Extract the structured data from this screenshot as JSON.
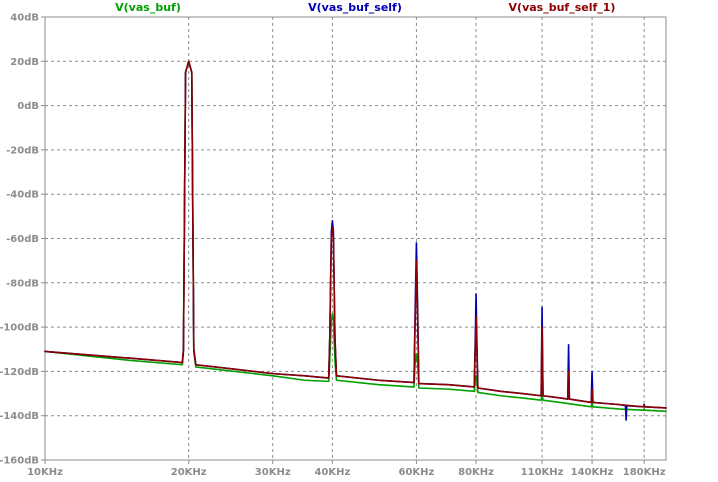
{
  "chart_data": {
    "type": "line",
    "x_scale": "log",
    "y_scale": "linear",
    "grid": true,
    "legend_position": "top",
    "xlim": [
      10000,
      200000
    ],
    "ylim": [
      -160,
      40
    ],
    "x_ticks": [
      {
        "value": 10000,
        "label": "10KHz"
      },
      {
        "value": 20000,
        "label": "20KHz"
      },
      {
        "value": 30000,
        "label": "30KHz"
      },
      {
        "value": 40000,
        "label": "40KHz"
      },
      {
        "value": 60000,
        "label": "60KHz"
      },
      {
        "value": 80000,
        "label": "80KHz"
      },
      {
        "value": 110000,
        "label": "110KHz"
      },
      {
        "value": 140000,
        "label": "140KHz"
      },
      {
        "value": 180000,
        "label": "180KHz"
      }
    ],
    "y_ticks": [
      {
        "value": 40,
        "label": "40dB"
      },
      {
        "value": 20,
        "label": "20dB"
      },
      {
        "value": 0,
        "label": "0dB"
      },
      {
        "value": -20,
        "label": "-20dB"
      },
      {
        "value": -40,
        "label": "-40dB"
      },
      {
        "value": -60,
        "label": "-60dB"
      },
      {
        "value": -80,
        "label": "-80dB"
      },
      {
        "value": -100,
        "label": "-100dB"
      },
      {
        "value": -120,
        "label": "-120dB"
      },
      {
        "value": -140,
        "label": "-140dB"
      },
      {
        "value": -160,
        "label": "-160dB"
      }
    ],
    "series": [
      {
        "name": "V(vas_buf)",
        "color": "#00a000",
        "points": [
          [
            10000,
            -111
          ],
          [
            15000,
            -115
          ],
          [
            19400,
            -117
          ],
          [
            19500,
            -111
          ],
          [
            19700,
            15
          ],
          [
            20000,
            20
          ],
          [
            20300,
            15
          ],
          [
            20500,
            -111
          ],
          [
            20700,
            -118
          ],
          [
            25000,
            -120
          ],
          [
            30000,
            -122
          ],
          [
            35000,
            -124
          ],
          [
            39300,
            -124.5
          ],
          [
            39500,
            -115
          ],
          [
            39800,
            -97
          ],
          [
            40000,
            -94
          ],
          [
            40200,
            -97
          ],
          [
            40500,
            -115
          ],
          [
            40800,
            -124
          ],
          [
            50000,
            -126
          ],
          [
            59000,
            -127
          ],
          [
            59300,
            -127
          ],
          [
            59600,
            -117
          ],
          [
            60000,
            -112
          ],
          [
            60400,
            -117
          ],
          [
            60700,
            -127.5
          ],
          [
            70000,
            -128
          ],
          [
            79300,
            -129
          ],
          [
            79700,
            -124
          ],
          [
            80000,
            -122
          ],
          [
            80300,
            -124
          ],
          [
            80700,
            -129.5
          ],
          [
            90000,
            -131
          ],
          [
            100000,
            -132
          ],
          [
            109500,
            -133
          ],
          [
            110000,
            -130
          ],
          [
            110500,
            -133
          ],
          [
            120000,
            -134
          ],
          [
            139400,
            -136
          ],
          [
            140000,
            -134
          ],
          [
            140600,
            -136
          ],
          [
            160000,
            -137
          ],
          [
            179500,
            -137.5
          ],
          [
            180000,
            -137
          ],
          [
            180500,
            -137.5
          ],
          [
            200000,
            -138
          ]
        ]
      },
      {
        "name": "V(vas_buf_self)",
        "color": "#0000b0",
        "points": [
          [
            10000,
            -111
          ],
          [
            15000,
            -114
          ],
          [
            19400,
            -116
          ],
          [
            19500,
            -110
          ],
          [
            19700,
            15
          ],
          [
            20000,
            20
          ],
          [
            20300,
            15
          ],
          [
            20500,
            -110
          ],
          [
            20700,
            -117
          ],
          [
            25000,
            -119
          ],
          [
            30000,
            -121
          ],
          [
            35000,
            -122
          ],
          [
            39300,
            -123
          ],
          [
            39500,
            -105
          ],
          [
            39800,
            -57
          ],
          [
            40000,
            -52
          ],
          [
            40200,
            -57
          ],
          [
            40500,
            -105
          ],
          [
            40800,
            -122
          ],
          [
            50000,
            -124
          ],
          [
            59000,
            -125
          ],
          [
            59300,
            -125
          ],
          [
            59600,
            -95
          ],
          [
            60000,
            -62
          ],
          [
            60400,
            -95
          ],
          [
            60700,
            -125.5
          ],
          [
            70000,
            -126
          ],
          [
            79300,
            -127
          ],
          [
            79700,
            -105
          ],
          [
            80000,
            -85
          ],
          [
            80300,
            -105
          ],
          [
            80700,
            -127.5
          ],
          [
            90000,
            -129
          ],
          [
            100000,
            -130
          ],
          [
            109500,
            -131
          ],
          [
            110000,
            -91
          ],
          [
            110500,
            -131
          ],
          [
            120000,
            -132
          ],
          [
            124500,
            -132.5
          ],
          [
            125000,
            -108
          ],
          [
            125500,
            -132.5
          ],
          [
            139400,
            -134
          ],
          [
            140000,
            -120
          ],
          [
            140600,
            -134
          ],
          [
            160000,
            -135
          ],
          [
            164500,
            -135.5
          ],
          [
            165000,
            -142
          ],
          [
            165500,
            -135.5
          ],
          [
            179500,
            -136
          ],
          [
            180000,
            -135
          ],
          [
            180500,
            -136
          ],
          [
            200000,
            -136.5
          ]
        ]
      },
      {
        "name": "V(vas_buf_self_1)",
        "color": "#8b0000",
        "points": [
          [
            10000,
            -111
          ],
          [
            15000,
            -114
          ],
          [
            19400,
            -116
          ],
          [
            19500,
            -110
          ],
          [
            19700,
            15
          ],
          [
            20000,
            20
          ],
          [
            20300,
            15
          ],
          [
            20500,
            -110
          ],
          [
            20700,
            -117
          ],
          [
            25000,
            -119
          ],
          [
            30000,
            -121
          ],
          [
            35000,
            -122
          ],
          [
            39300,
            -123
          ],
          [
            39500,
            -105
          ],
          [
            39800,
            -60
          ],
          [
            40000,
            -55
          ],
          [
            40200,
            -60
          ],
          [
            40500,
            -105
          ],
          [
            40800,
            -122
          ],
          [
            50000,
            -124
          ],
          [
            59000,
            -125
          ],
          [
            59300,
            -125
          ],
          [
            59600,
            -100
          ],
          [
            60000,
            -70
          ],
          [
            60400,
            -100
          ],
          [
            60700,
            -125.5
          ],
          [
            70000,
            -126
          ],
          [
            79300,
            -127
          ],
          [
            79700,
            -110
          ],
          [
            80000,
            -95
          ],
          [
            80300,
            -110
          ],
          [
            80700,
            -127.5
          ],
          [
            90000,
            -129
          ],
          [
            100000,
            -130
          ],
          [
            109500,
            -131
          ],
          [
            110000,
            -100
          ],
          [
            110500,
            -131
          ],
          [
            120000,
            -132
          ],
          [
            124500,
            -132.5
          ],
          [
            125000,
            -120
          ],
          [
            125500,
            -132.5
          ],
          [
            139400,
            -134
          ],
          [
            140000,
            -128
          ],
          [
            140600,
            -134
          ],
          [
            160000,
            -135
          ],
          [
            179500,
            -136
          ],
          [
            180000,
            -135
          ],
          [
            180500,
            -136
          ],
          [
            200000,
            -136.5
          ]
        ]
      }
    ]
  }
}
